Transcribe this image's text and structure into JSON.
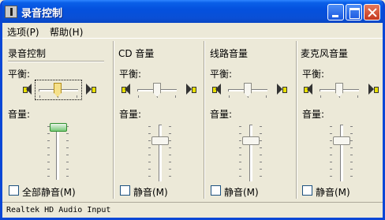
{
  "window": {
    "title": "录音控制"
  },
  "menu": {
    "options": "选项(P)",
    "help": "帮助(H)"
  },
  "labels": {
    "balance": "平衡:",
    "volume": "音量:"
  },
  "columns": [
    {
      "title": "录音控制",
      "mute_label": "全部静音(M)",
      "balance": 0.5,
      "volume": 1.0,
      "muted": false,
      "focused": true
    },
    {
      "title": "CD 音量",
      "mute_label": "静音(M)",
      "balance": 0.5,
      "volume": 0.75,
      "muted": false,
      "focused": false
    },
    {
      "title": "线路音量",
      "mute_label": "静音(M)",
      "balance": 0.5,
      "volume": 0.75,
      "muted": false,
      "focused": false
    },
    {
      "title": "麦克风音量",
      "mute_label": "静音(M)",
      "balance": 0.5,
      "volume": 0.75,
      "muted": false,
      "focused": false
    }
  ],
  "status": {
    "text": "Realtek HD Audio Input"
  },
  "colors": {
    "titlebar": "#0a4fd5",
    "face": "#ece9d8",
    "active_thumb": "#77c977"
  }
}
